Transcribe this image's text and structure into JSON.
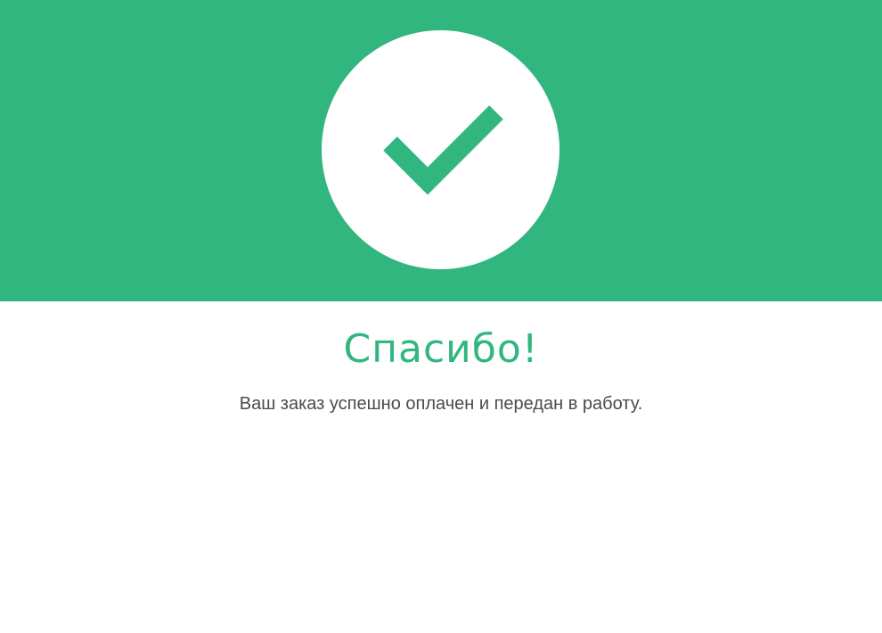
{
  "header": {
    "icon": "checkmark-icon"
  },
  "content": {
    "title": "Спасибо!",
    "message": "Ваш заказ успешно оплачен и передан в работу."
  },
  "colors": {
    "accent": "#32b67f",
    "background": "#ffffff",
    "text": "#4b4b4b"
  }
}
